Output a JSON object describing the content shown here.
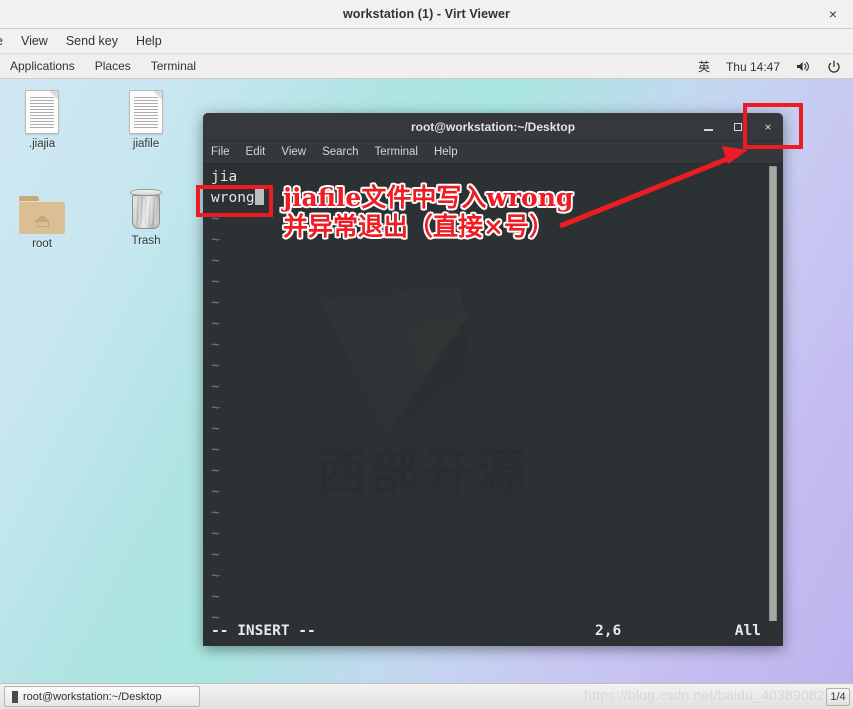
{
  "viewer": {
    "title": "workstation (1) - Virt Viewer",
    "close_label": "×",
    "menu": [
      {
        "label": "e"
      },
      {
        "label": "View"
      },
      {
        "label": "Send key"
      },
      {
        "label": "Help"
      }
    ]
  },
  "gnome_panel": {
    "items": [
      {
        "label": "Applications"
      },
      {
        "label": "Places"
      },
      {
        "label": "Terminal"
      }
    ],
    "input_method": "英",
    "clock": "Thu 14:47",
    "volume_icon": "volume-icon",
    "power_icon": "power-icon"
  },
  "desktop": {
    "icons": [
      {
        "name": "jiajia-file",
        "label": ".jiajia",
        "type": "file"
      },
      {
        "name": "jiafile-file",
        "label": "jiafile",
        "type": "file"
      },
      {
        "name": "root-folder",
        "label": "root",
        "type": "folder"
      },
      {
        "name": "trash",
        "label": "Trash",
        "type": "trash"
      }
    ]
  },
  "terminal": {
    "title": "root@workstation:~/Desktop",
    "minimize_label": "–",
    "maximize_label": "□",
    "close_label": "×",
    "menu": [
      {
        "label": "File"
      },
      {
        "label": "Edit"
      },
      {
        "label": "View"
      },
      {
        "label": "Search"
      },
      {
        "label": "Terminal"
      },
      {
        "label": "Help"
      }
    ],
    "watermark_text": "西部开源",
    "buffer": [
      {
        "text": "jia",
        "tilde": false
      },
      {
        "text": "wrong",
        "tilde": false,
        "cursor": true
      },
      {
        "text": "~",
        "tilde": true
      },
      {
        "text": "~",
        "tilde": true
      },
      {
        "text": "~",
        "tilde": true
      },
      {
        "text": "~",
        "tilde": true
      },
      {
        "text": "~",
        "tilde": true
      },
      {
        "text": "~",
        "tilde": true
      },
      {
        "text": "~",
        "tilde": true
      },
      {
        "text": "~",
        "tilde": true
      },
      {
        "text": "~",
        "tilde": true
      },
      {
        "text": "~",
        "tilde": true
      },
      {
        "text": "~",
        "tilde": true
      },
      {
        "text": "~",
        "tilde": true
      },
      {
        "text": "~",
        "tilde": true
      },
      {
        "text": "~",
        "tilde": true
      },
      {
        "text": "~",
        "tilde": true
      },
      {
        "text": "~",
        "tilde": true
      },
      {
        "text": "~",
        "tilde": true
      },
      {
        "text": "~",
        "tilde": true
      },
      {
        "text": "~",
        "tilde": true
      },
      {
        "text": "~",
        "tilde": true
      }
    ],
    "status": {
      "mode": "-- INSERT --",
      "position": "2,6",
      "scroll": "All"
    }
  },
  "annotations": {
    "line1": "jiafile文件中写入wrong",
    "line2": "并异常退出（直接×号）",
    "color": "#ed1c24"
  },
  "taskbar": {
    "window_button": "root@workstation:~/Desktop",
    "watermark": "https://blog.csdn.net/baidu_40389082",
    "workspace": "1/4"
  }
}
